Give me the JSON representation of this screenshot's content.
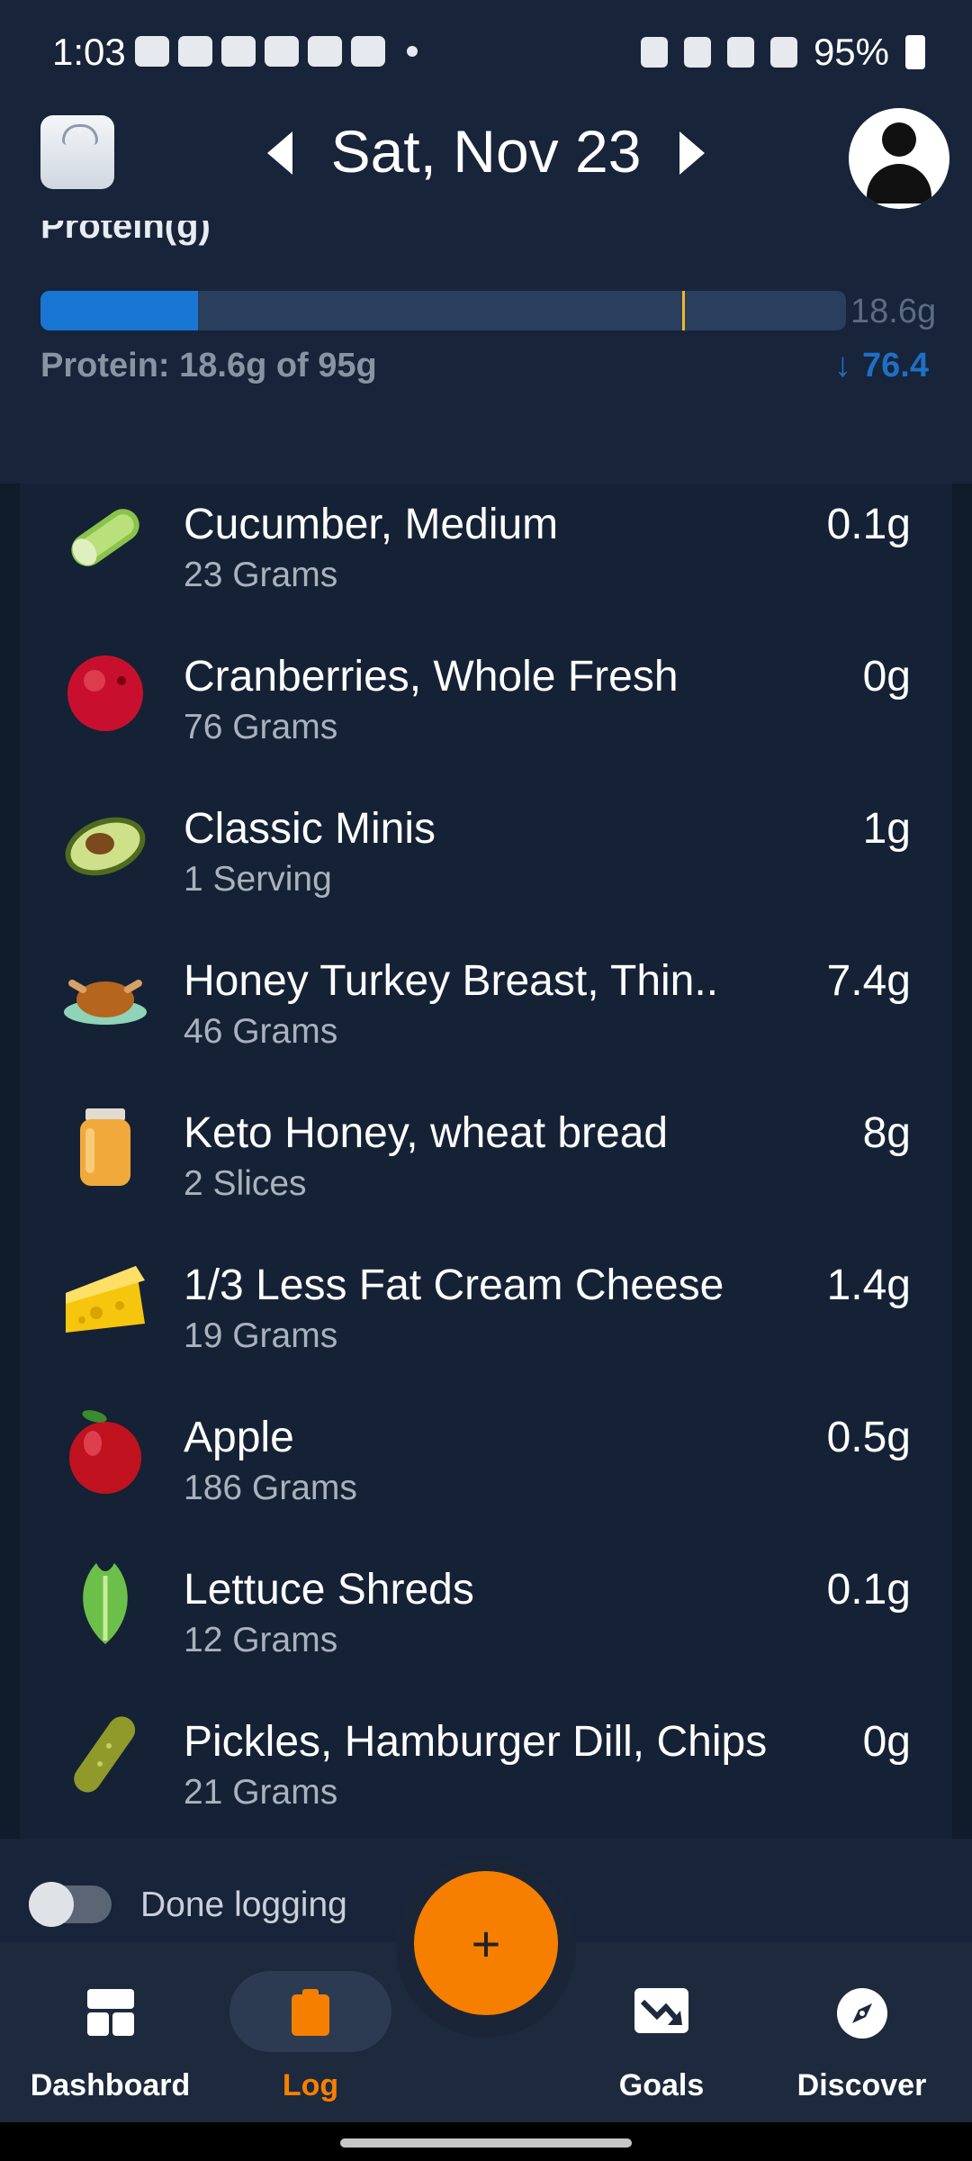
{
  "status_bar": {
    "time": "1:03",
    "battery": "95%",
    "icons": [
      "game-controller-icon",
      "game-controller-icon",
      "b-icon",
      "youtube-icon",
      "youtube-icon",
      "youtube-icon",
      "dot-icon",
      "battery-saver-icon",
      "mute-icon",
      "wifi-icon",
      "signal-icon",
      "battery-icon"
    ]
  },
  "header": {
    "date": "Sat, Nov 23",
    "left_icon": "scale-icon",
    "right_icon": "account-avatar-icon"
  },
  "summary": {
    "title": "Protein(g)",
    "progress_label": "Protein: 18.6g of 95g",
    "bar_end_label": "18.6g",
    "remaining": "76.4",
    "remaining_arrow": "↓",
    "fill_fraction": 0.196,
    "colors": {
      "fill": "#1976d2",
      "track": "#2a3f5e",
      "marker": "#f5b429",
      "remaining": "#1f6fc4"
    }
  },
  "foods": [
    {
      "name": "Cucumber, Medium",
      "qty": "23 Grams",
      "amount": "0.1g",
      "icon": "cucumber-icon"
    },
    {
      "name": "Cranberries, Whole Fresh",
      "qty": "76 Grams",
      "amount": "0g",
      "icon": "cranberry-icon"
    },
    {
      "name": "Classic Minis",
      "qty": "1 Serving",
      "amount": "1g",
      "icon": "avocado-icon"
    },
    {
      "name": "Honey Turkey Breast, Thin..",
      "qty": "46 Grams",
      "amount": "7.4g",
      "icon": "turkey-icon"
    },
    {
      "name": "Keto Honey, wheat bread",
      "qty": "2 Slices",
      "amount": "8g",
      "icon": "honey-jar-icon"
    },
    {
      "name": "1/3 Less Fat Cream Cheese",
      "qty": "19 Grams",
      "amount": "1.4g",
      "icon": "cheese-icon"
    },
    {
      "name": "Apple",
      "qty": "186 Grams",
      "amount": "0.5g",
      "icon": "apple-icon"
    },
    {
      "name": "Lettuce Shreds",
      "qty": "12 Grams",
      "amount": "0.1g",
      "icon": "lettuce-icon"
    },
    {
      "name": "Pickles, Hamburger Dill, Chips",
      "qty": "21 Grams",
      "amount": "0g",
      "icon": "pickle-icon"
    }
  ],
  "footer": {
    "done_logging": "Done logging",
    "fab": "+"
  },
  "nav": {
    "dashboard": "Dashboard",
    "log": "Log",
    "goals": "Goals",
    "discover": "Discover",
    "accent": "#f77f00"
  }
}
